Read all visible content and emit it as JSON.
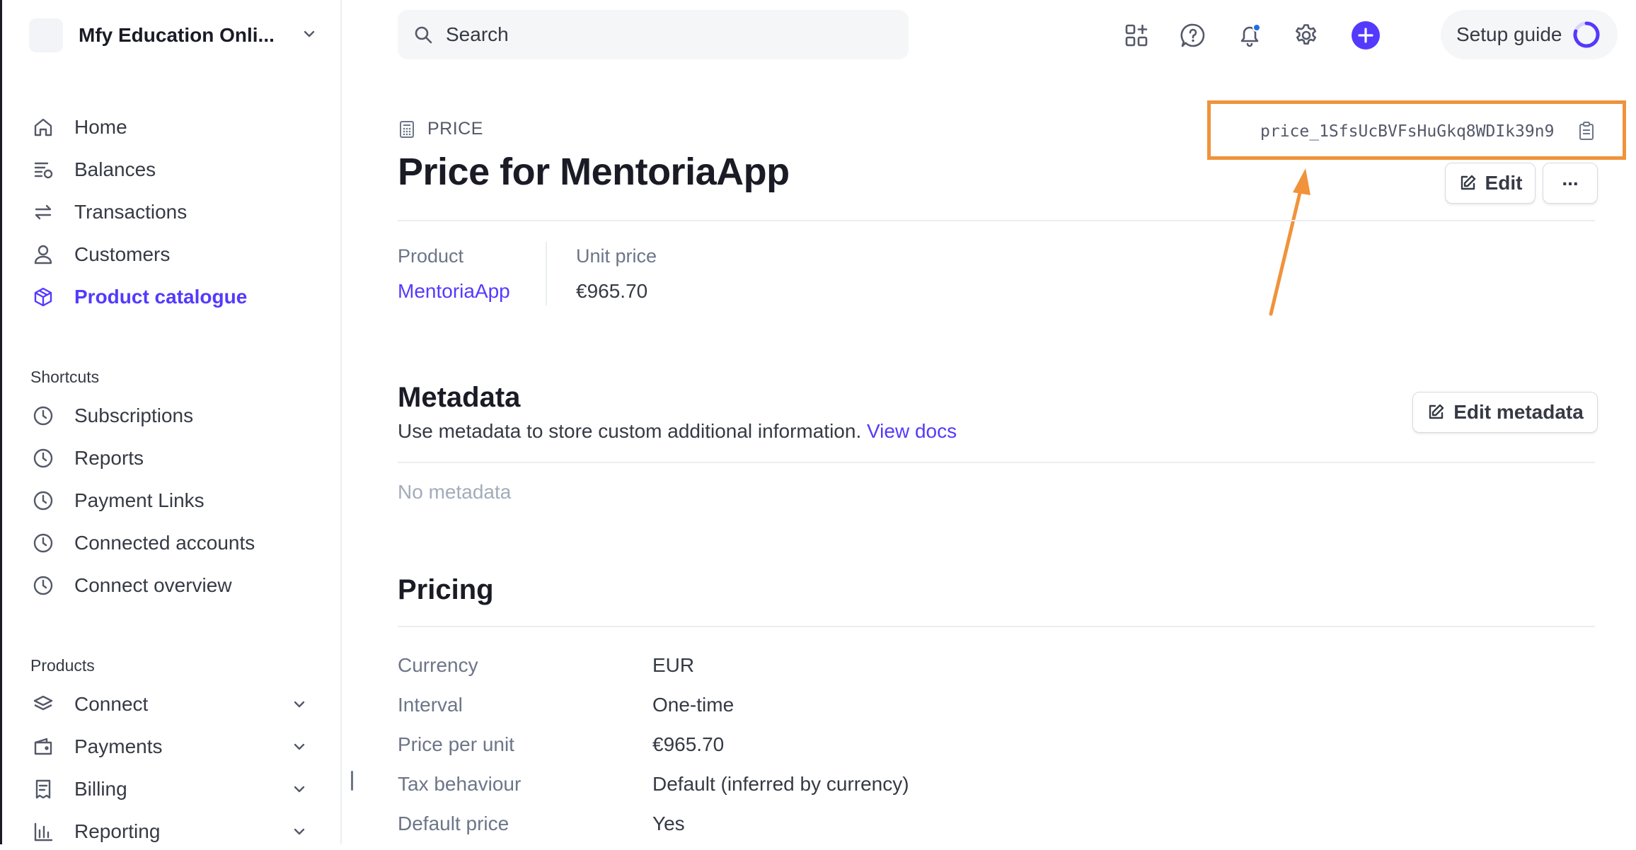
{
  "account": {
    "name": "Mfy Education Onli..."
  },
  "sidebar": {
    "nav": [
      {
        "label": "Home",
        "icon": "home-icon"
      },
      {
        "label": "Balances",
        "icon": "balances-icon"
      },
      {
        "label": "Transactions",
        "icon": "transactions-icon"
      },
      {
        "label": "Customers",
        "icon": "customers-icon"
      },
      {
        "label": "Product catalogue",
        "icon": "product-catalogue-icon",
        "active": true
      }
    ],
    "shortcuts_heading": "Shortcuts",
    "shortcuts": [
      {
        "label": "Subscriptions",
        "icon": "clock-icon"
      },
      {
        "label": "Reports",
        "icon": "clock-icon"
      },
      {
        "label": "Payment Links",
        "icon": "clock-icon"
      },
      {
        "label": "Connected accounts",
        "icon": "clock-icon"
      },
      {
        "label": "Connect overview",
        "icon": "clock-icon"
      }
    ],
    "products_heading": "Products",
    "products": [
      {
        "label": "Connect",
        "icon": "connect-icon"
      },
      {
        "label": "Payments",
        "icon": "payments-icon"
      },
      {
        "label": "Billing",
        "icon": "billing-icon"
      },
      {
        "label": "Reporting",
        "icon": "reporting-icon"
      }
    ]
  },
  "topbar": {
    "search_placeholder": "Search",
    "icons": [
      "apps-icon",
      "help-icon",
      "notifications-icon",
      "settings-icon",
      "create-icon"
    ],
    "setup_guide_label": "Setup guide"
  },
  "page": {
    "crumb": "PRICE",
    "title": "Price for MentoriaApp",
    "price_id": "price_1SfsUcBVFsHuGkq8WDIk39n9",
    "edit_label": "Edit",
    "more_label": "...",
    "summary": {
      "product_label": "Product",
      "product_value": "MentoriaApp",
      "unit_price_label": "Unit price",
      "unit_price_value": "€965.70"
    },
    "metadata": {
      "title": "Metadata",
      "description": "Use metadata to store custom additional information.",
      "docs_link": "View docs",
      "edit_label": "Edit metadata",
      "empty": "No metadata"
    },
    "pricing": {
      "title": "Pricing",
      "rows": [
        {
          "label": "Currency",
          "value": "EUR"
        },
        {
          "label": "Interval",
          "value": "One-time"
        },
        {
          "label": "Price per unit",
          "value": "€965.70"
        },
        {
          "label": "Tax behaviour",
          "value": "Default (inferred by currency)"
        },
        {
          "label": "Default price",
          "value": "Yes"
        }
      ]
    }
  },
  "colors": {
    "accent": "#533afd",
    "annotation": "#f0933b",
    "text": "#353a44",
    "muted": "#6c7688"
  }
}
